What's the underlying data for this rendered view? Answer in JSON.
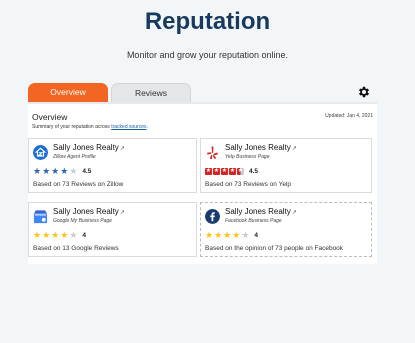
{
  "page": {
    "title": "Reputation",
    "subtitle": "Monitor and grow your reputation online."
  },
  "tabs": [
    {
      "label": "Overview",
      "active": true
    },
    {
      "label": "Reviews",
      "active": false
    }
  ],
  "settings_icon": "gear-icon",
  "overview": {
    "title": "Overview",
    "summary_prefix": "Summary of your reputation across",
    "summary_link": "tracked sources",
    "summary_suffix": ".",
    "updated": "Updated: Jan 4, 2021"
  },
  "colors": {
    "accent": "#f26522",
    "title": "#173a5e",
    "star_blue": "#2f67b1",
    "star_gold": "#f7c51b",
    "yelp_red": "#d32323",
    "facebook": "#1a3b6e"
  },
  "cards": [
    {
      "name": "Sally Jones Realty",
      "source": "Zillow Agent Profile",
      "rating": "4.5",
      "based": "Based on 73 Reviews on Zillow",
      "icon": "zillow-icon"
    },
    {
      "name": "Sally Jones Realty",
      "source": "Yelp Business Page",
      "rating": "4.5",
      "based": "Based on 73 Reviews on Yelp",
      "icon": "yelp-icon"
    },
    {
      "name": "Sally Jones Realty",
      "source": "Google My Business Page",
      "rating": "4",
      "based": "Based on 13 Google Reviews",
      "icon": "google-my-business-icon"
    },
    {
      "name": "Sally Jones Realty",
      "source": "Facebook Business Page",
      "rating": "4",
      "based": "Based on the opinion of 73 people on Facebook",
      "icon": "facebook-icon"
    }
  ]
}
